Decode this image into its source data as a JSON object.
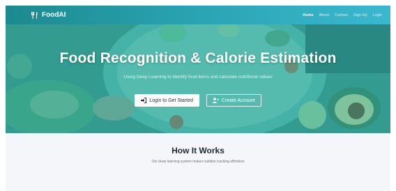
{
  "navbar": {
    "brand_icon": "utensils-icon",
    "brand": "FoodAI",
    "links": [
      {
        "label": "Home",
        "active": true
      },
      {
        "label": "About"
      },
      {
        "label": "Contact"
      },
      {
        "label": "Sign Up"
      },
      {
        "label": "Login"
      }
    ]
  },
  "hero": {
    "title": "Food Recognition & Calorie Estimation",
    "subtitle": "Using Deep Learning to identify food items and calculate nutritional values",
    "login_button": {
      "icon": "sign-in-icon",
      "label": "Login to Get Started"
    },
    "create_button": {
      "icon": "user-plus-icon",
      "label": "Create Account"
    }
  },
  "how_it_works": {
    "title": "How It Works",
    "subtitle": "Our deep learning system makes nutrition tracking effortless"
  },
  "colors": {
    "navbar_start": "#1c8a8e",
    "navbar_end": "#3bb8cf",
    "hero_overlay": "#26aaa0",
    "section_bg": "#f4f6f9"
  }
}
